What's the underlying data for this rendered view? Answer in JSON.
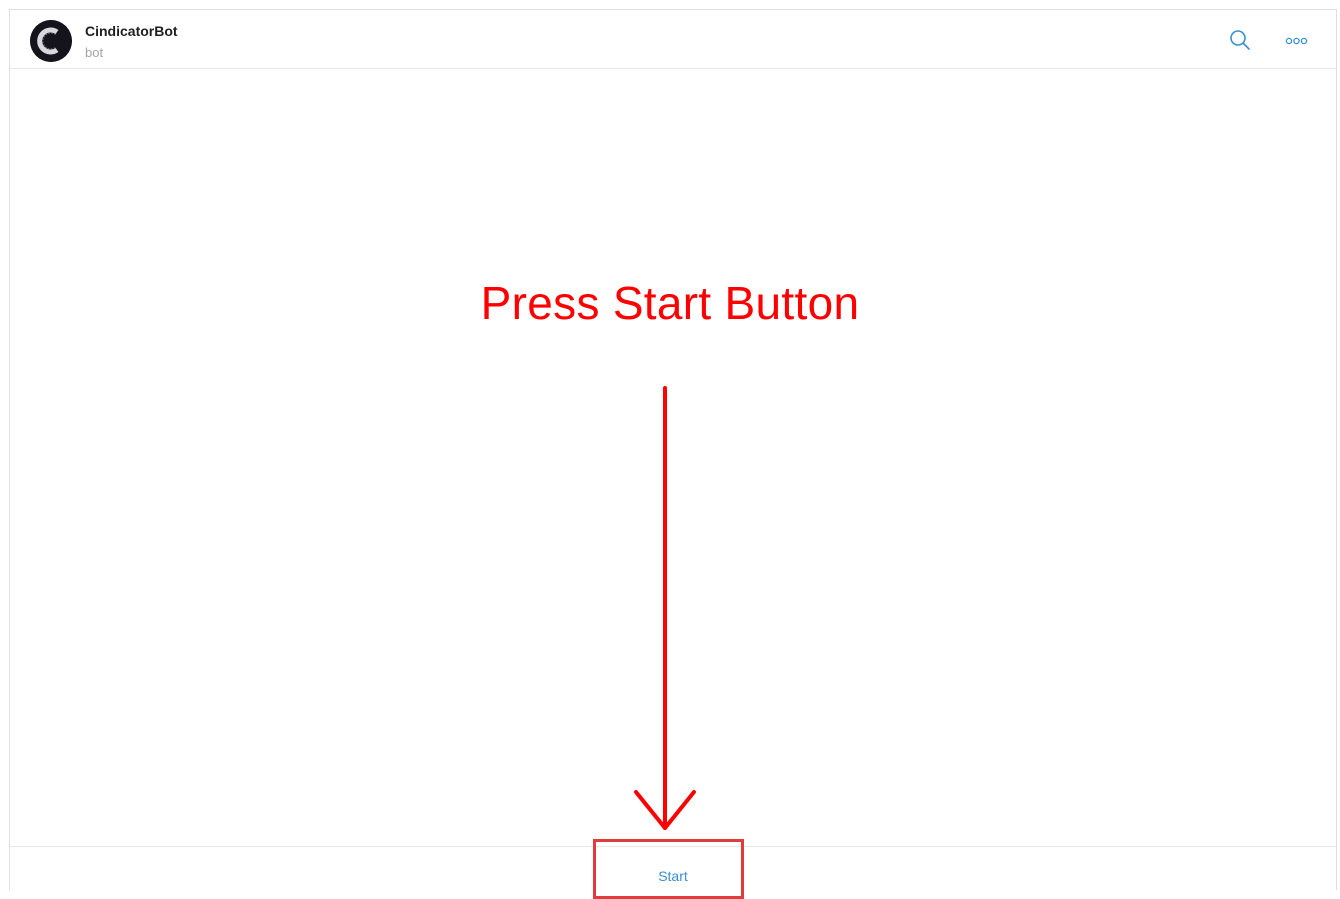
{
  "header": {
    "chat_title": "CindicatorBot",
    "chat_status": "bot",
    "avatar_letter": "C",
    "icons": [
      "search-icon",
      "more-icon"
    ]
  },
  "bottom_bar": {
    "start_label": "Start"
  },
  "annotation": {
    "text": "Press Start Button",
    "color": "#ff0000"
  },
  "colors": {
    "accent": "#3a8fd0",
    "avatar_bg": "#15131c",
    "border": "#e7e7e7"
  }
}
